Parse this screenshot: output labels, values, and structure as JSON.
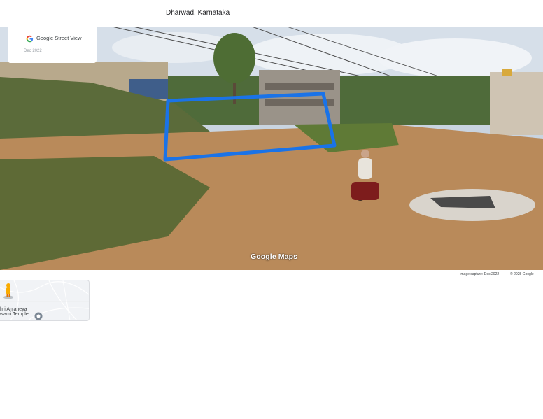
{
  "location_title": "Dharwad, Karnataka",
  "street_view_card": {
    "label": "Google Street View",
    "date": "Dec 2022"
  },
  "watermark": "Google Maps",
  "footer": {
    "image_capture": "Image capture: Dec 2022",
    "copyright": "© 2025 Google"
  },
  "minimap": {
    "place_label": "hri Anjaneya\nwami Temple"
  },
  "colors": {
    "annotation_outline": "#1a73e8",
    "dirt": "#b98a5a",
    "sky": "#cfd9e6"
  },
  "icons": [
    "google-g-icon",
    "pegman-icon",
    "temple-pin-icon",
    "compass-marker-icon"
  ]
}
